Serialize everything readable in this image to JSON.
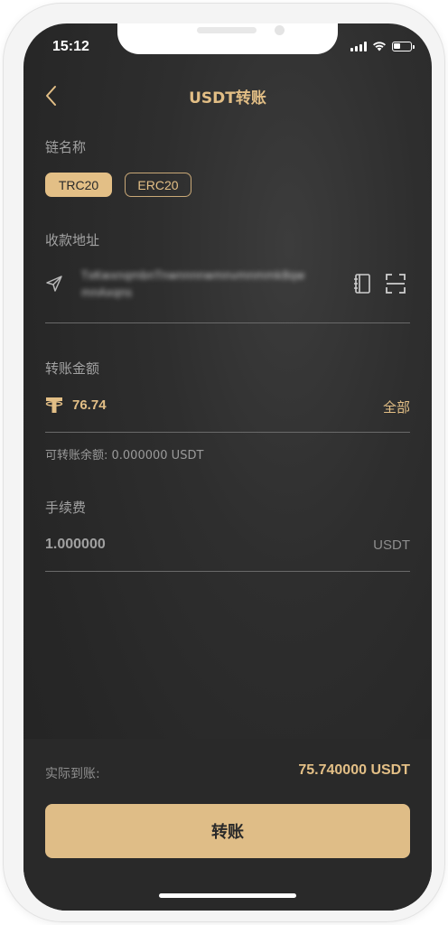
{
  "status_bar": {
    "time": "15:12",
    "battery_level": 0.4
  },
  "header": {
    "back_icon": "chevron-left-icon",
    "title": "USDT转账"
  },
  "chain": {
    "label": "链名称",
    "options": [
      "TRC20",
      "ERC20"
    ],
    "selected": "TRC20"
  },
  "address": {
    "label": "收款地址",
    "value": "TxKwxnqmbnTnwnnnnwmnvmnmmk8qwmnAxqns",
    "icons": [
      "send-icon",
      "address-book-icon",
      "scan-icon"
    ]
  },
  "amount": {
    "label": "转账金额",
    "currency_icon": "tether-icon",
    "value": "76.74",
    "all_label": "全部"
  },
  "balance": {
    "text": "可转账余额: 0.000000 USDT"
  },
  "fee": {
    "label": "手续费",
    "value": "1.000000",
    "unit": "USDT"
  },
  "summary": {
    "actual_label": "实际到账:",
    "actual_value": "75.740000 USDT"
  },
  "actions": {
    "submit_label": "转账"
  },
  "colors": {
    "accent": "#e3bf86",
    "background": "#2a2a2a"
  }
}
